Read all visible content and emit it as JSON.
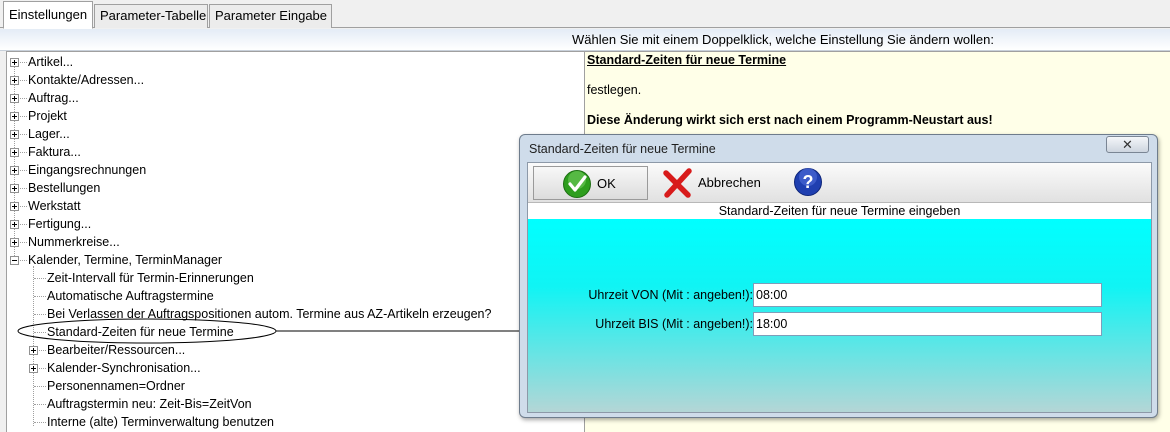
{
  "tabs": [
    {
      "label": "Einstellungen",
      "active": true
    },
    {
      "label": "Parameter-Tabelle",
      "active": false
    },
    {
      "label": "Parameter Eingabe",
      "active": false
    }
  ],
  "instruction": "Wählen Sie mit einem Doppelklick, welche Einstellung Sie ändern wollen:",
  "tree": {
    "root_items": [
      "Artikel...",
      "Kontakte/Adressen...",
      "Auftrag...",
      "Projekt",
      "Lager...",
      "Faktura...",
      "Eingangsrechnungen",
      "Bestellungen",
      "Werkstatt",
      "Fertigung...",
      "Nummerkreise...",
      "Kalender, Termine, TerminManager"
    ],
    "child_items": [
      "Zeit-Intervall für Termin-Erinnerungen",
      "Automatische Auftragstermine",
      "Bei Verlassen der Auftragspositionen autom. Termine aus AZ-Artikeln erzeugen?",
      "Standard-Zeiten für neue Termine",
      "Bearbeiter/Ressourcen...",
      "Kalender-Synchronisation...",
      "Personennamen=Ordner",
      "Auftragstermin neu: Zeit-Bis=ZeitVon",
      "Interne (alte) Terminverwaltung benutzen"
    ]
  },
  "info": {
    "title": "Standard-Zeiten für neue Termine",
    "line": "festlegen.",
    "warning": "Diese Änderung wirkt sich erst nach einem Programm-Neustart aus!"
  },
  "dialog": {
    "title": "Standard-Zeiten für neue Termine",
    "ok_label": "OK",
    "cancel_label": "Abbrechen",
    "subtitle": "Standard-Zeiten für neue Termine eingeben",
    "from_label": "Uhrzeit VON (Mit : angeben!):",
    "from_value": "08:00",
    "to_label": "Uhrzeit BIS (Mit : angeben!):",
    "to_value": "18:00"
  },
  "icons": {
    "close": "close-icon",
    "ok": "checkmark-icon",
    "cancel": "red-x-icon",
    "help": "question-mark-icon"
  },
  "colors": {
    "form_gradient_top": "#00ffff",
    "info_panel_bg": "#ffffe8",
    "ok_green": "#2e9e1e",
    "cancel_red": "#d81b1b",
    "help_blue": "#1f3fb0"
  }
}
